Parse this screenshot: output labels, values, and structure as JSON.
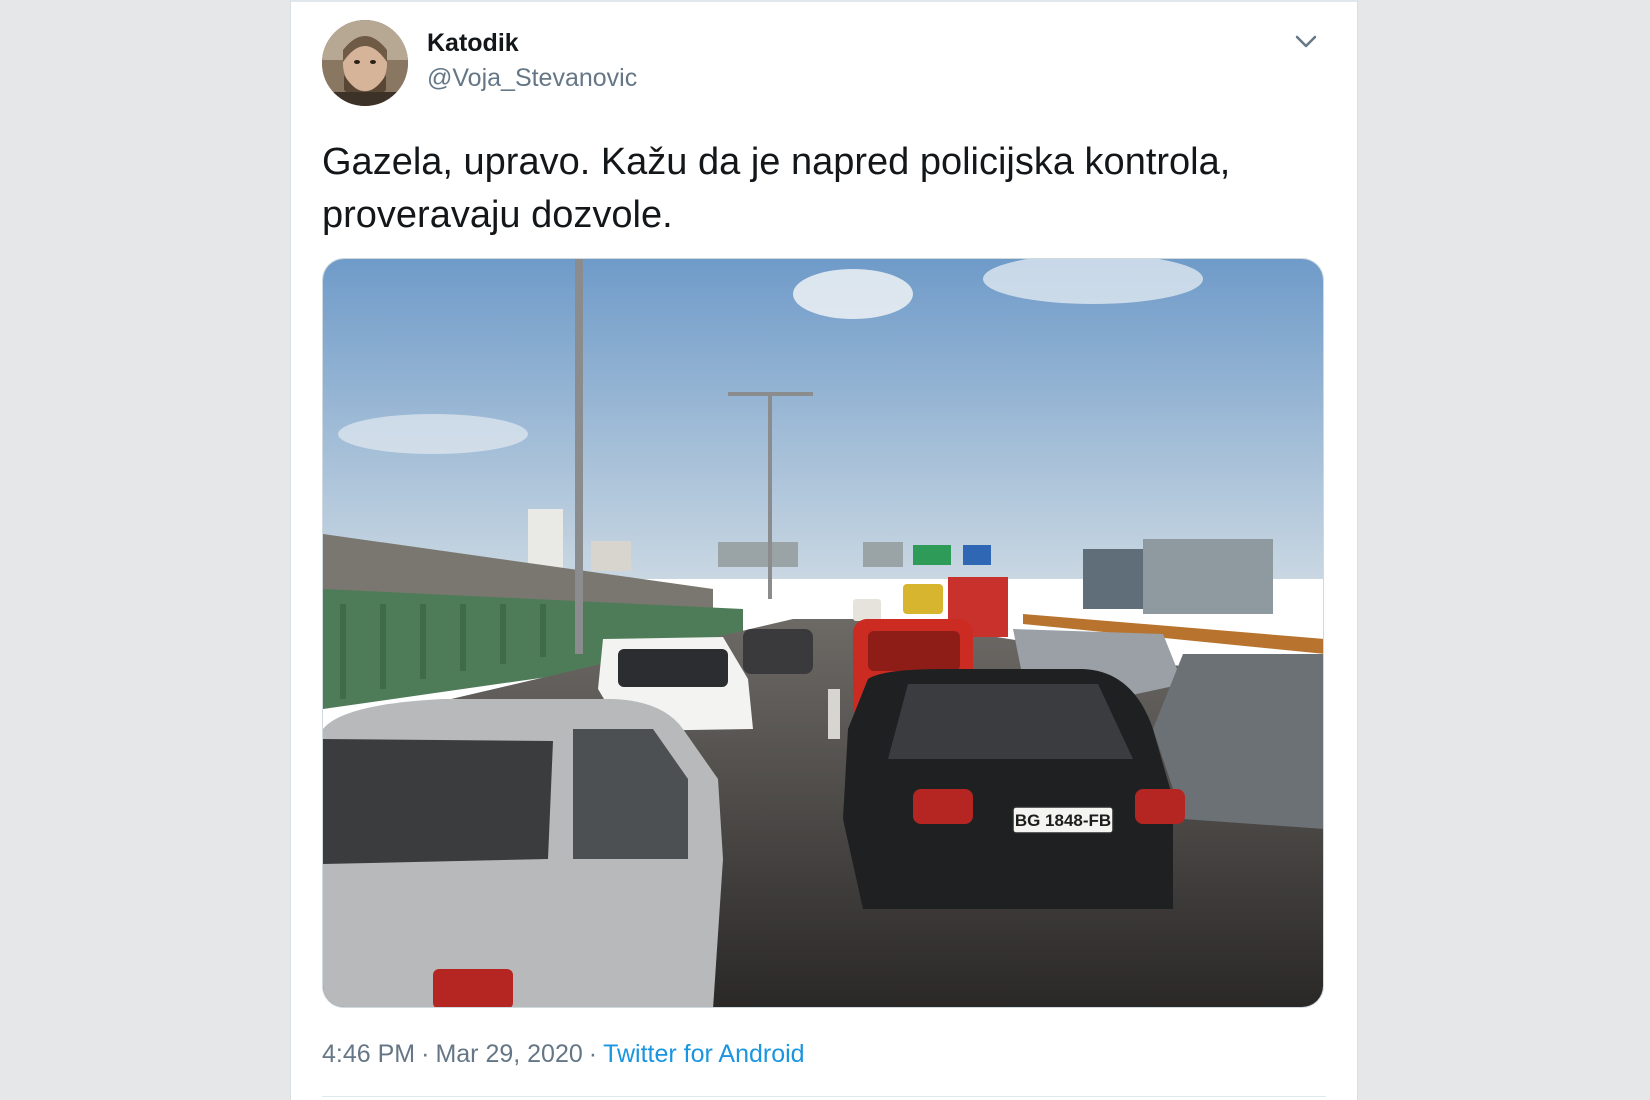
{
  "tweet": {
    "author_name": "Katodik",
    "author_handle": "@Voja_Stevanovic",
    "text": "Gazela, upravo. Kažu da je napred policijska kontrola, proveravaju dozvole.",
    "time": "4:46 PM",
    "separator": "·",
    "date": "Mar 29, 2020",
    "source": "Twitter for Android",
    "plate_text": "BG 1848-FB"
  },
  "icons": {
    "more": "chevron-down-icon",
    "avatar": "avatar-photo"
  },
  "colors": {
    "name": "#14171a",
    "secondary": "#657786",
    "link": "#1b95e0",
    "background": "#e6e7e9",
    "card": "#ffffff"
  }
}
